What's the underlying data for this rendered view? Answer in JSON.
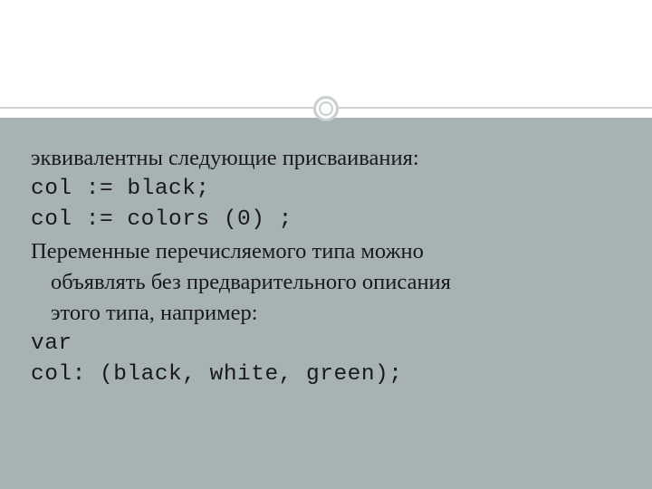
{
  "body": {
    "line1": "эквивалентны следующие присваивания:",
    "code1": "col := black;",
    "code2": "col := colors (0) ;",
    "para2_l1": "Переменные перечисляемого типа можно",
    "para2_l2": "объявлять без предварительного описания",
    "para2_l3": "этого типа, например:",
    "code3": "var",
    "code4": "col: (black, white, green);"
  }
}
